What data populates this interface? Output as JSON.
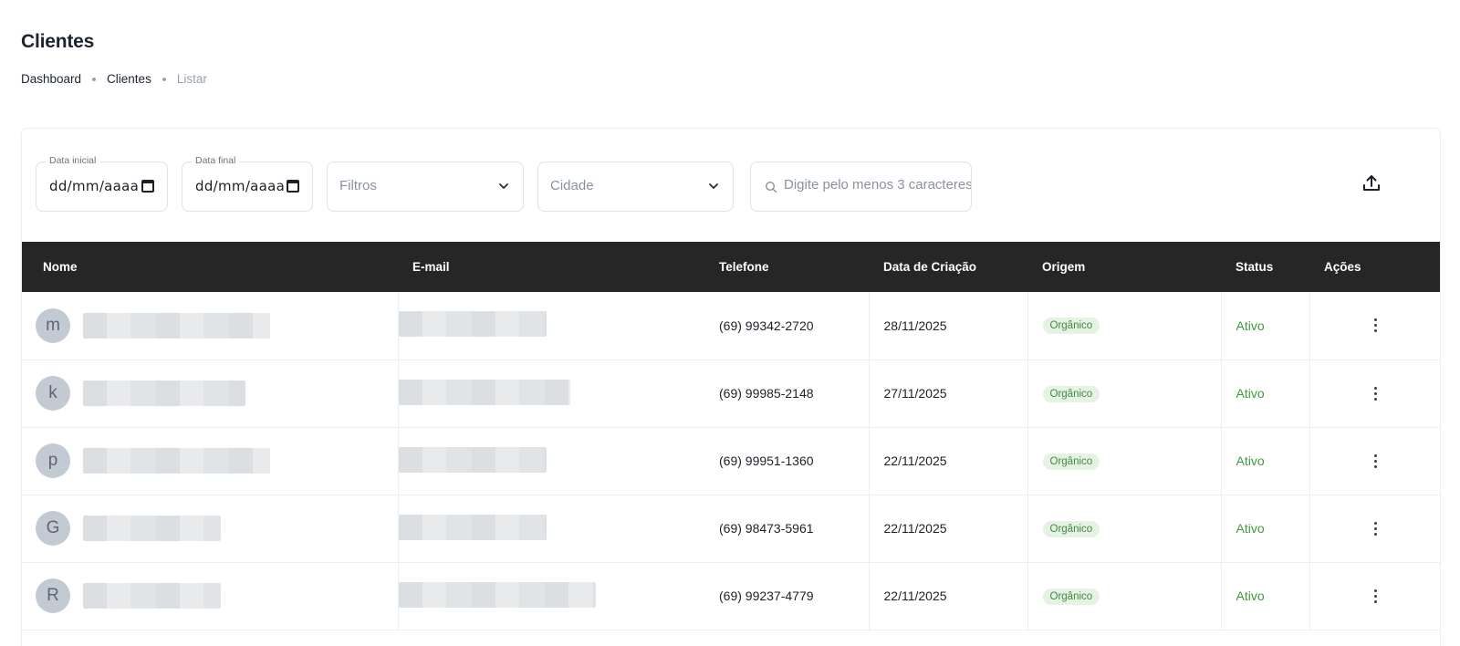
{
  "page": {
    "title": "Clientes",
    "breadcrumb": [
      "Dashboard",
      "Clientes",
      "Listar"
    ]
  },
  "filters": {
    "start_date": {
      "label": "Data inicial",
      "value": "dd/mm/aaaa"
    },
    "end_date": {
      "label": "Data final",
      "value": "dd/mm/aaaa"
    },
    "filtros": {
      "value": "Filtros"
    },
    "cidade": {
      "value": "Cidade"
    },
    "search": {
      "placeholder": "Digite pelo menos 3 caracteres"
    },
    "export_icon": "upload-icon"
  },
  "table": {
    "columns": [
      "Nome",
      "E-mail",
      "Telefone",
      "Data de Criação",
      "Origem",
      "Status",
      "Ações"
    ],
    "rows": [
      {
        "avatar": "m",
        "telefone": "(69) 99342-2720",
        "data_criacao": "28/11/2025",
        "origem": "Orgânico",
        "status": "Ativo"
      },
      {
        "avatar": "k",
        "telefone": "(69) 99985-2148",
        "data_criacao": "27/11/2025",
        "origem": "Orgânico",
        "status": "Ativo"
      },
      {
        "avatar": "p",
        "telefone": "(69) 99951-1360",
        "data_criacao": "22/11/2025",
        "origem": "Orgânico",
        "status": "Ativo"
      },
      {
        "avatar": "G",
        "telefone": "(69) 98473-5961",
        "data_criacao": "22/11/2025",
        "origem": "Orgânico",
        "status": "Ativo"
      },
      {
        "avatar": "R",
        "telefone": "(69) 99237-4779",
        "data_criacao": "22/11/2025",
        "origem": "Orgânico",
        "status": "Ativo"
      }
    ]
  },
  "colors": {
    "header_bg": "#262626",
    "status_active": "#3e9b3e",
    "badge_bg": "#e6f2e4",
    "avatar_bg": "#c4cad4"
  }
}
